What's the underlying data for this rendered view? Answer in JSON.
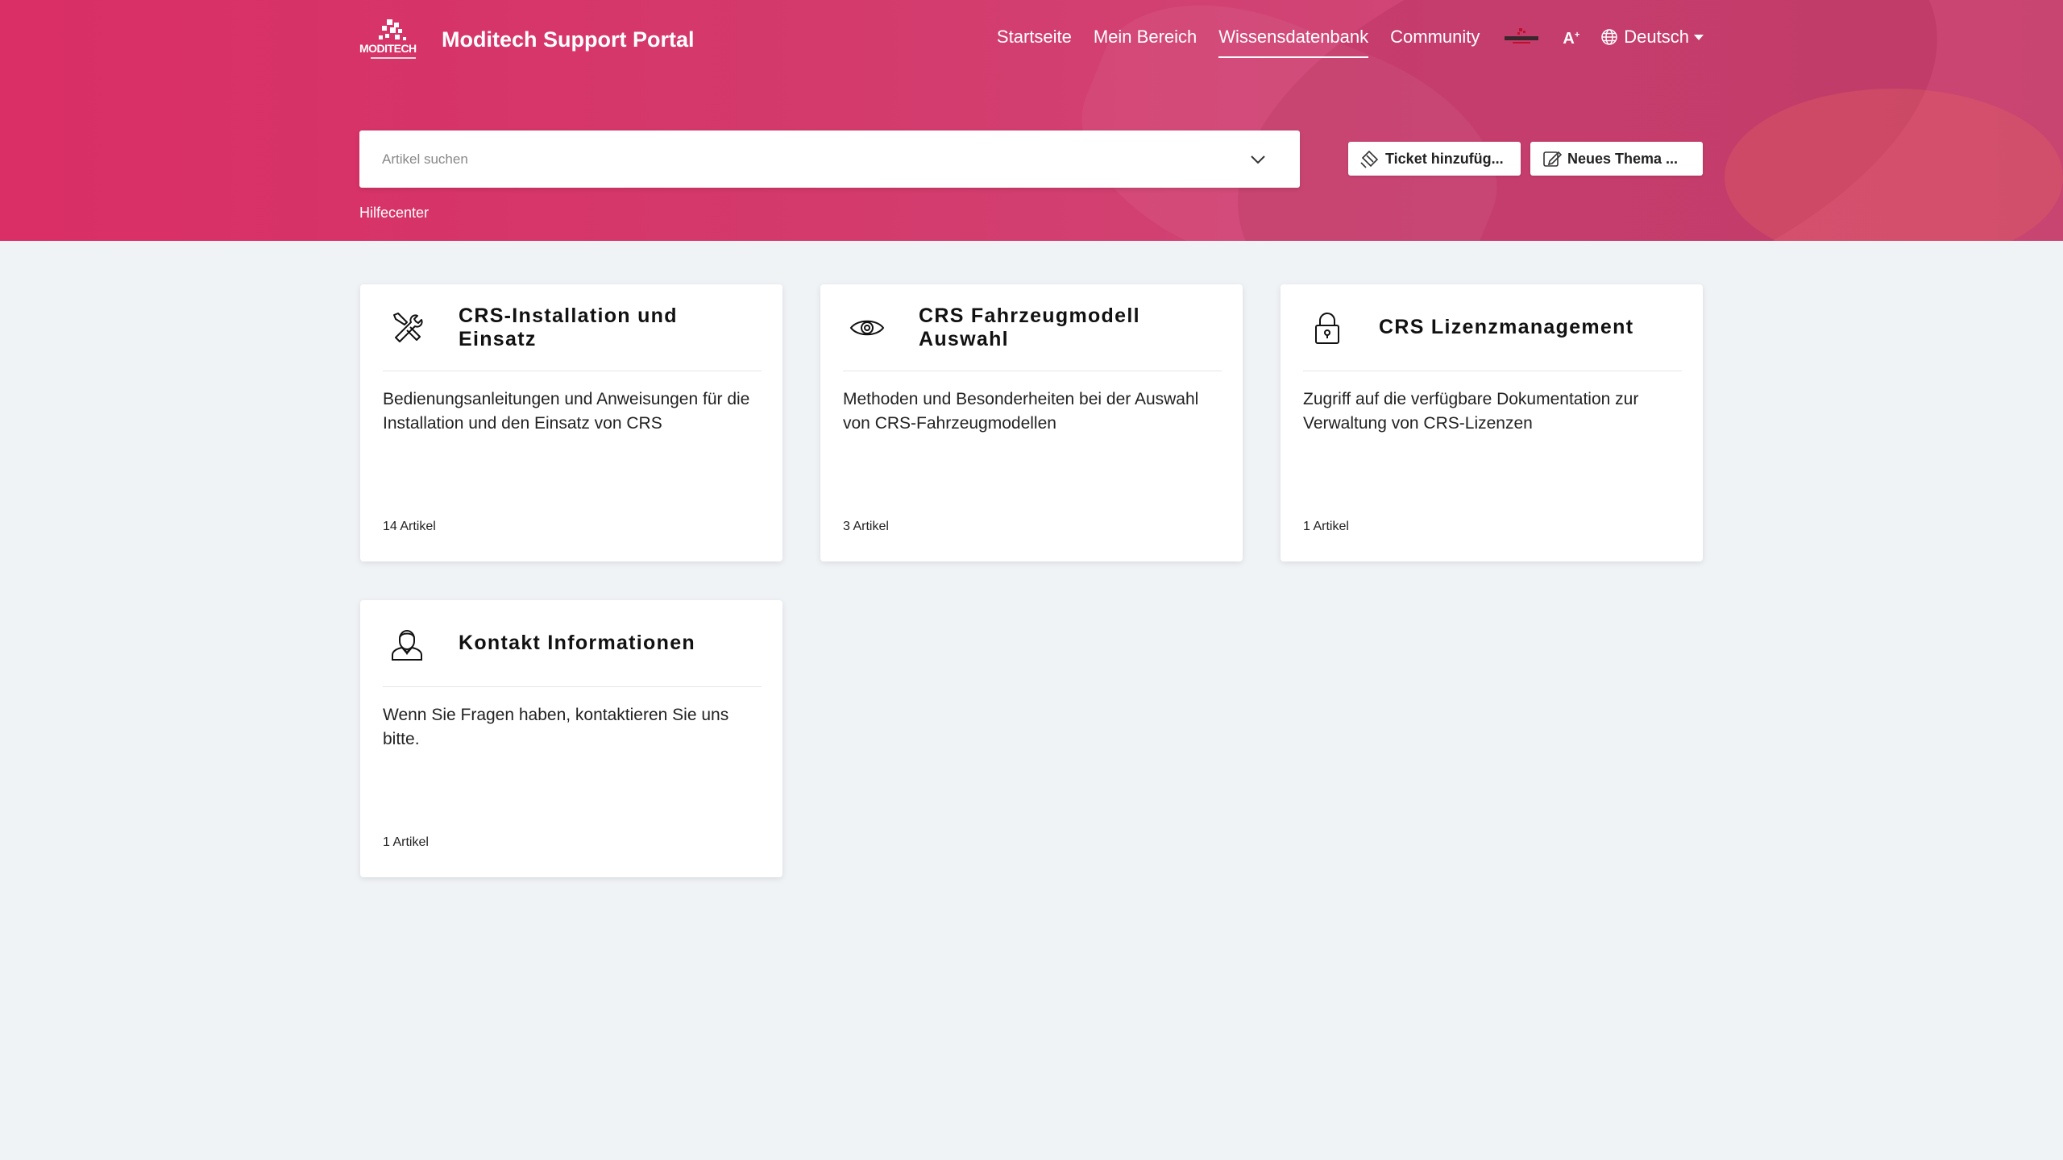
{
  "header": {
    "title": "Moditech Support Portal",
    "logo_text": "MODITECH",
    "nav": [
      {
        "label": "Startseite"
      },
      {
        "label": "Mein Bereich"
      },
      {
        "label": "Wissensdatenbank",
        "active": true
      },
      {
        "label": "Community"
      }
    ],
    "font_size_label": "A",
    "language": "Deutsch",
    "brand_color": "#d6386b"
  },
  "search": {
    "placeholder": "Artikel suchen",
    "value": ""
  },
  "actions": {
    "ticket_label": "Ticket hinzufüg...",
    "topic_label": "Neues Thema ..."
  },
  "breadcrumb": "Hilfecenter",
  "cards": [
    {
      "icon": "tools-icon",
      "title": "CRS-Installation und Einsatz",
      "description": "Bedienungsanleitungen und Anweisungen für die Installation und den Einsatz von CRS",
      "count": "14 Artikel"
    },
    {
      "icon": "eye-icon",
      "title": "CRS Fahrzeugmodell Auswahl",
      "description": "Methoden und Besonderheiten bei der Auswahl von CRS-Fahrzeugmodellen",
      "count": "3 Artikel"
    },
    {
      "icon": "lock-icon",
      "title": "CRS Lizenzmanagement",
      "description": "Zugriff auf die verfügbare Dokumentation zur Verwaltung von CRS-Lizenzen",
      "count": "1 Artikel"
    },
    {
      "icon": "person-icon",
      "title": "Kontakt Informationen",
      "description": "Wenn Sie Fragen haben, kontaktieren Sie uns bitte.",
      "count": "1 Artikel"
    }
  ]
}
